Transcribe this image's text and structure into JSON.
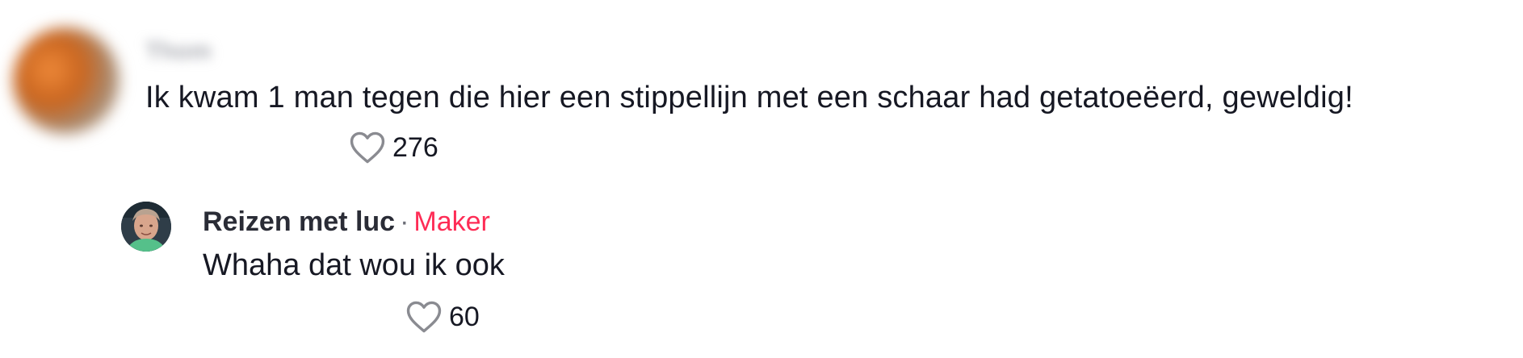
{
  "comment": {
    "username": "Thom",
    "text": "Ik kwam 1 man tegen die hier een stippellijn met een schaar had getatoeëerd, geweldig!",
    "likes": "276"
  },
  "reply": {
    "author": "Reizen met luc",
    "separator": "·",
    "badge": "Maker",
    "text": "Whaha dat wou ik ook",
    "likes": "60"
  },
  "colors": {
    "text": "#161823",
    "creator_badge": "#fe2c55",
    "icon": "#8a8b91"
  },
  "icons": {
    "like": "heart-outline-icon"
  }
}
